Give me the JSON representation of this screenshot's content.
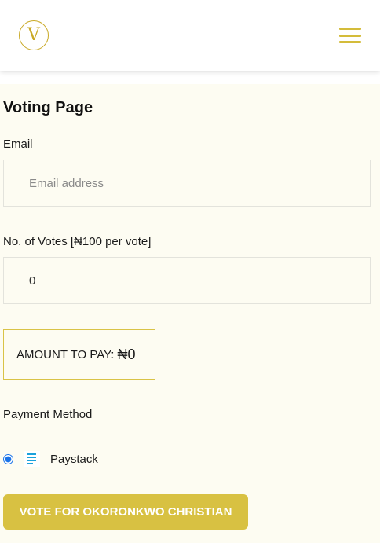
{
  "header": {
    "logo_letter": "V",
    "menu_icon": "hamburger-menu-icon"
  },
  "page": {
    "title": "Voting Page"
  },
  "form": {
    "email_label": "Email",
    "email_placeholder": "Email address",
    "email_value": "",
    "votes_label": "No. of Votes [₦100 per vote]",
    "votes_value": "0",
    "amount_label": "AMOUNT TO PAY:",
    "amount_value": "₦0",
    "payment_label": "Payment Method",
    "payment_option": "Paystack",
    "payment_icon": "paystack-icon",
    "submit_label": "VOTE FOR OKORONKWO CHRISTIAN"
  },
  "colors": {
    "accent": "#d8c142",
    "logo": "#c9a925",
    "background": "#fdfcf2",
    "radio": "#1a73e8",
    "paystack": "#1aa1dc"
  }
}
